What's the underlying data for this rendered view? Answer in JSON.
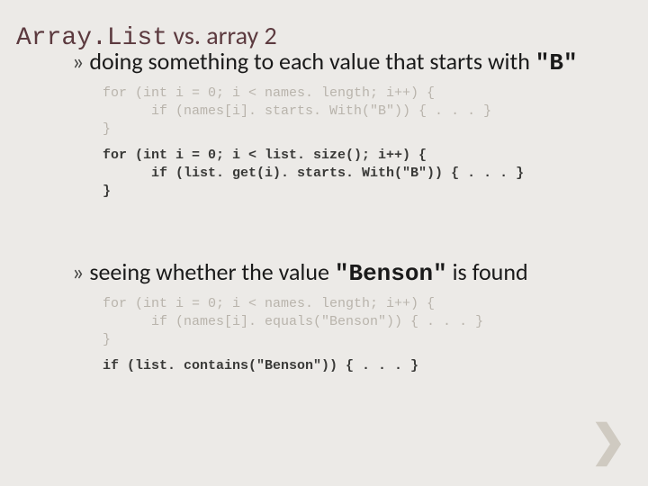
{
  "title": {
    "mono_part": "Array.List",
    "rest": " vs. array 2"
  },
  "section1": {
    "bullet_pre": "doing something to each value that starts with ",
    "bullet_mono": "\"B\"",
    "code_faded": "for (int i = 0; i < names. length; i++) {\n      if (names[i]. starts. With(\"B\")) { . . . }\n}",
    "code_strong": "for (int i = 0; i < list. size(); i++) {\n      if (list. get(i). starts. With(\"B\")) { . . . }\n}"
  },
  "section2": {
    "bullet_pre": "seeing whether the value ",
    "bullet_mono": "\"Benson\"",
    "bullet_post": " is found",
    "code_faded": "for (int i = 0; i < names. length; i++) {\n      if (names[i]. equals(\"Benson\")) { . . . }\n}",
    "code_strong": "if (list. contains(\"Benson\")) { . . . }"
  },
  "nav_glyph": "❯"
}
